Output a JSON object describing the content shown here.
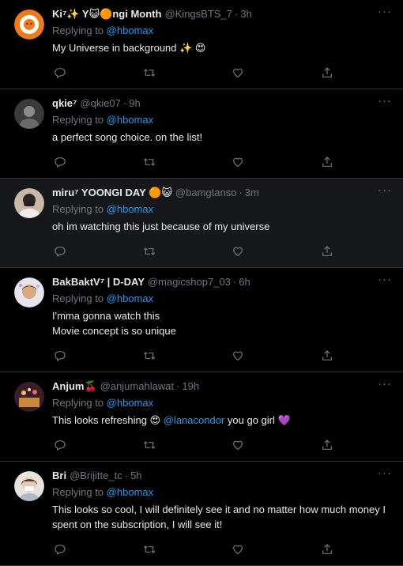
{
  "replying_label": "Replying to",
  "icons": [
    "more-icon",
    "reply-icon",
    "retweet-icon",
    "like-icon",
    "share-icon"
  ],
  "colors": {
    "background": "#000000",
    "highlight_background": "#16181c",
    "mention": "#1d9bf0",
    "muted": "#71767b",
    "divider": "#2f3336"
  },
  "tweets": [
    {
      "display_name": "Ki⁷✨ Y😺🟠ngi Month",
      "handle": "@KingsBTS_7",
      "time": "3h",
      "replying_to": "@hbomax",
      "lines": [
        "My Universe in background ✨ 😍"
      ]
    },
    {
      "display_name": "qkie⁷",
      "handle": "@qkie07",
      "time": "9h",
      "replying_to": "@hbomax",
      "lines": [
        "a perfect song choice. on the list!"
      ]
    },
    {
      "display_name": "miru⁷ YOONGI DAY 🟠😺",
      "handle": "@bamgtanso",
      "time": "3m",
      "replying_to": "@hbomax",
      "lines": [
        "oh im watching this just because of my universe"
      ]
    },
    {
      "display_name": "BakBaktV⁷ | D-DAY",
      "handle": "@magicshop7_03",
      "time": "6h",
      "replying_to": "@hbomax",
      "lines": [
        "I'mma gonna watch this",
        "Movie concept is so unique"
      ]
    },
    {
      "display_name": "Anjum🍒",
      "handle": "@anjumahlawat",
      "time": "19h",
      "replying_to": "@hbomax",
      "body_before": "This looks refreshing 😍",
      "body_mention": "@lanacondor",
      "body_after": "you go girl 💜"
    },
    {
      "display_name": "Bri",
      "handle": "@Brijitte_tc",
      "time": "5h",
      "replying_to": "@hbomax",
      "lines": [
        "This looks so cool, I will definitely see it and no matter how much money I",
        "spent on the subscription, I will see it!"
      ]
    }
  ]
}
